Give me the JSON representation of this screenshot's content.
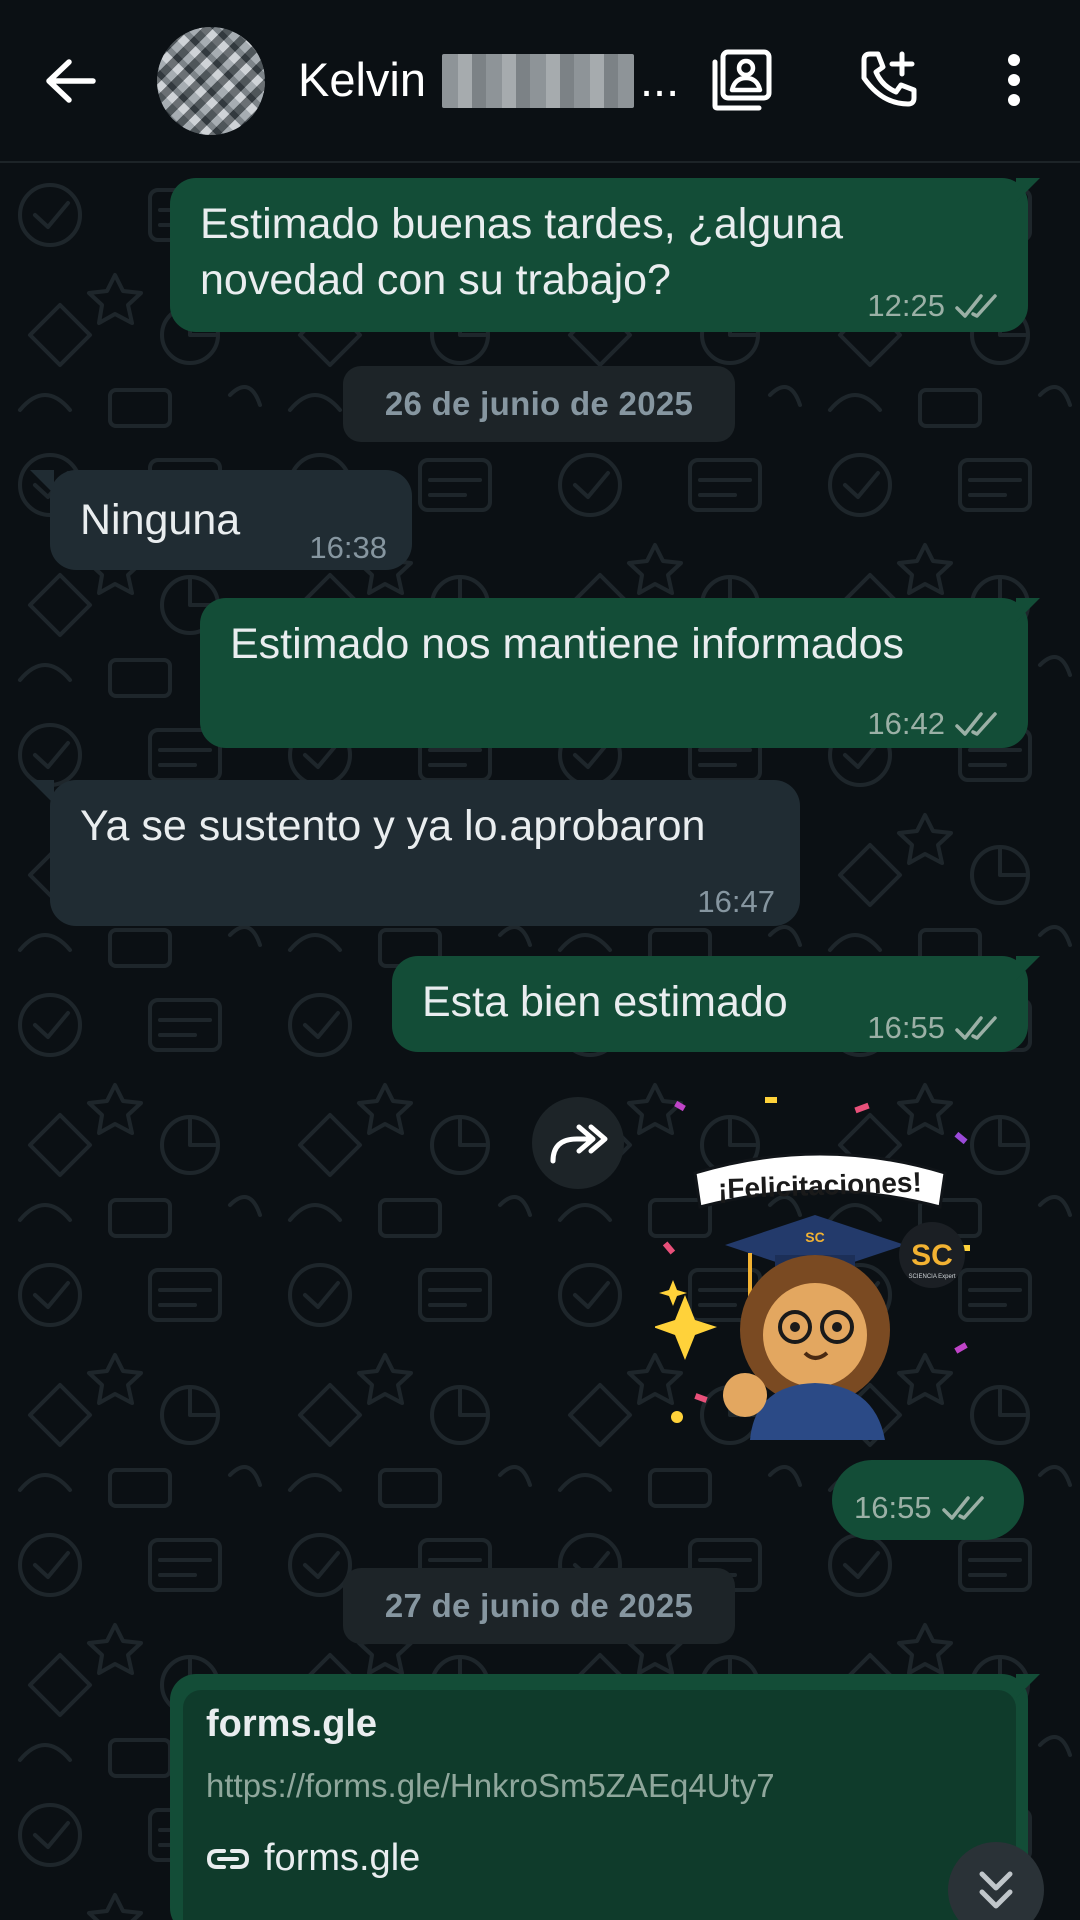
{
  "header": {
    "contact_name": "Kelvin",
    "name_suffix": "..."
  },
  "messages": [
    {
      "direction": "out",
      "text_line1": "Estimado buenas tardes, ¿alguna",
      "text_line2": "novedad con su trabajo?",
      "time": "12:25"
    },
    {
      "direction": "in",
      "text": "Ninguna",
      "time": "16:38"
    },
    {
      "direction": "out",
      "text": "Estimado nos mantiene informados",
      "time": "16:42"
    },
    {
      "direction": "in",
      "text": "Ya se sustento y ya lo.aprobaron",
      "time": "16:47"
    },
    {
      "direction": "out",
      "text": "Esta bien estimado",
      "time": "16:55"
    },
    {
      "direction": "out",
      "type": "sticker",
      "time": "16:55"
    }
  ],
  "dates": {
    "first": "26 de junio de 2025",
    "second": "27 de junio de 2025"
  },
  "sticker": {
    "banner": "¡Felicitaciones!",
    "cap_label": "SC",
    "brand": "SC",
    "brand_tagline": "SCIENCIA Expert"
  },
  "link_preview": {
    "title": "forms.gle",
    "url": "https://forms.gle/HnkroSm5ZAEq4Uty7",
    "domain": "forms.gle"
  },
  "colors": {
    "outgoing": "#134d37",
    "incoming": "#202c33",
    "background": "#0b1014"
  }
}
